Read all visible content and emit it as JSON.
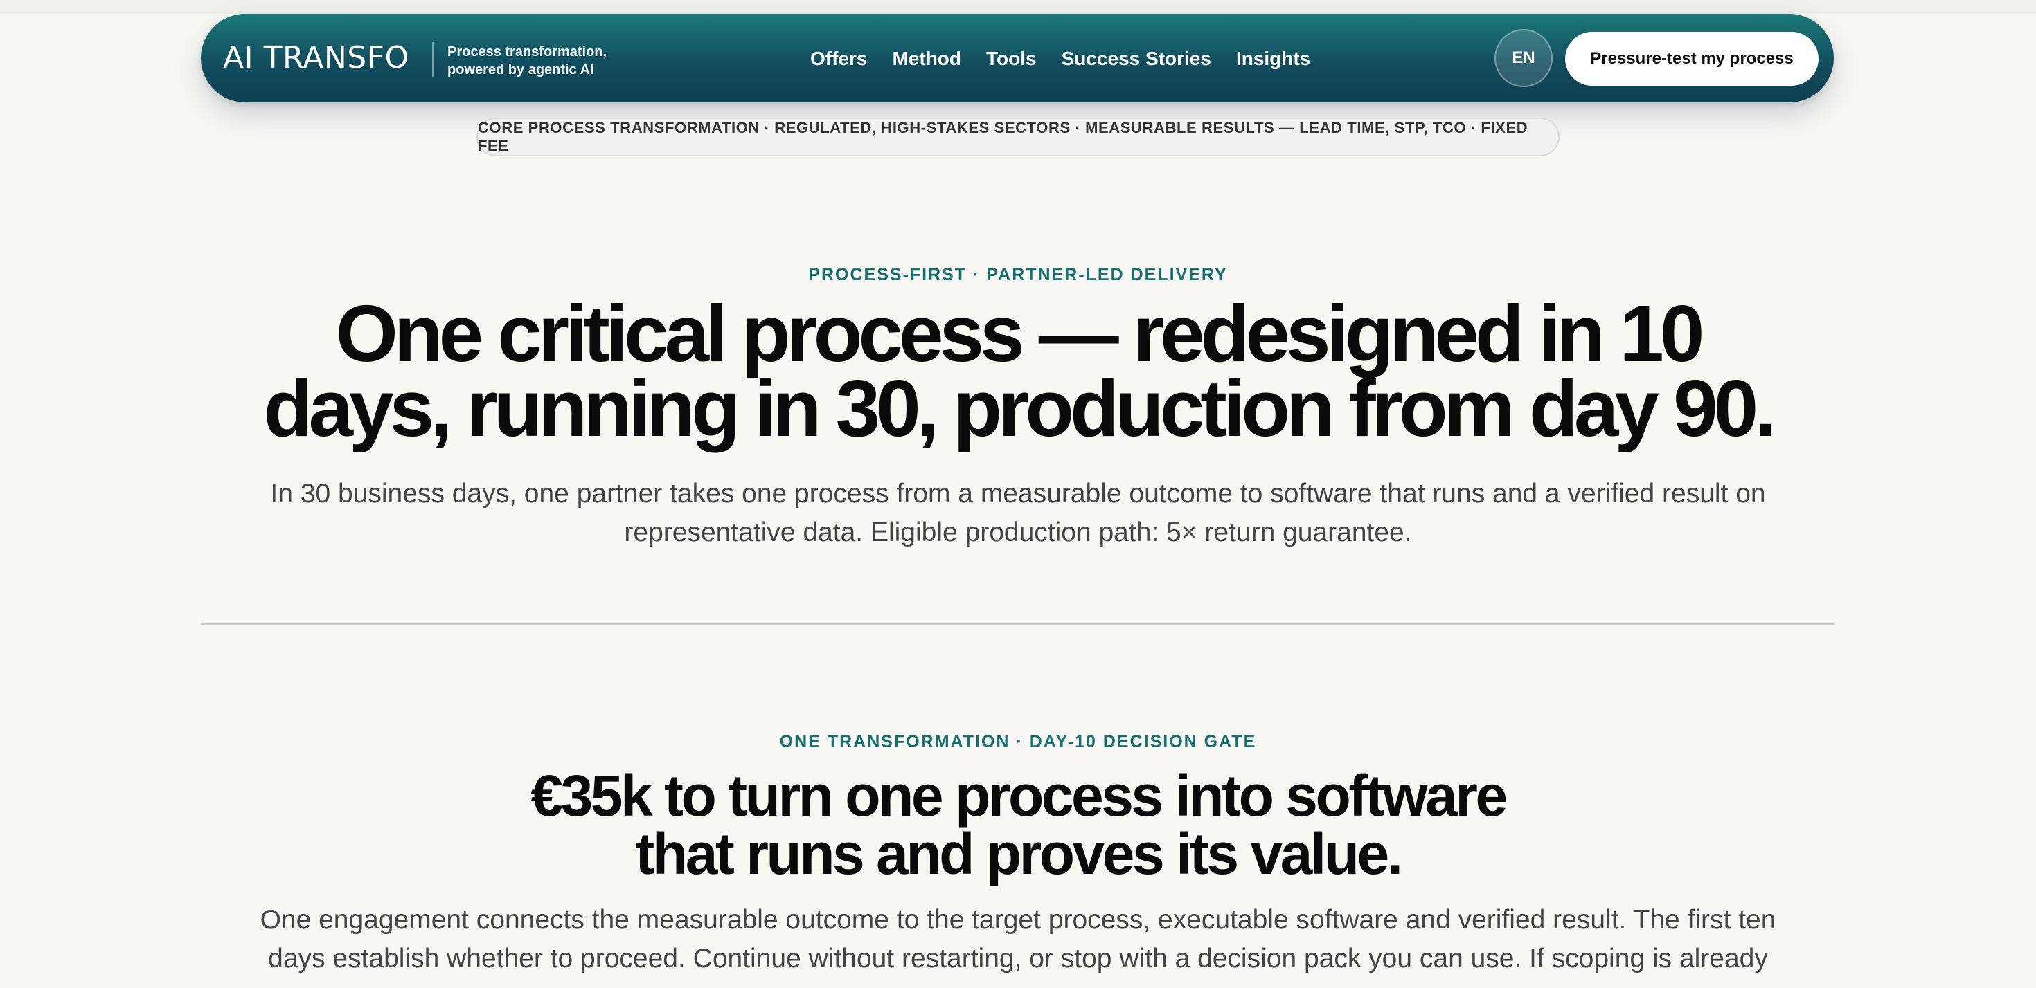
{
  "header": {
    "brand": "AI TRANSFO",
    "tagline_line1": "Process transformation,",
    "tagline_line2": "powered by agentic AI",
    "nav": [
      "Offers",
      "Method",
      "Tools",
      "Success Stories",
      "Insights"
    ],
    "language": "EN",
    "cta": "Pressure-test my process"
  },
  "banner": "CORE PROCESS TRANSFORMATION · REGULATED, HIGH-STAKES SECTORS · MEASURABLE RESULTS — LEAD TIME, STP, TCO · FIXED FEE",
  "hero": {
    "eyebrow": "PROCESS-FIRST · PARTNER-LED DELIVERY",
    "title_line1": "One critical process — redesigned in 10",
    "title_line2": "days, running in 30, production from day 90.",
    "lede_line1": "In 30 business days, one partner takes one process from a measurable outcome to software that runs and a verified result on",
    "lede_line2": "representative data. Eligible production path: 5× return guarantee."
  },
  "offer": {
    "eyebrow": "ONE TRANSFORMATION · DAY-10 DECISION GATE",
    "title_line1": "€35k to turn one process into software",
    "title_line2": "that runs and proves its value.",
    "lede_line1": "One engagement connects the measurable outcome to the target process, executable software and verified result. The first ten",
    "lede_line2": "days establish whether to proceed. Continue without restarting, or stop with a decision pack you can use. If scoping is already"
  },
  "colors": {
    "nav_gradient_top": "#1c7a78",
    "nav_gradient_bottom": "#0d3f52",
    "accent": "#146f6e",
    "background": "#f8f7f4"
  }
}
